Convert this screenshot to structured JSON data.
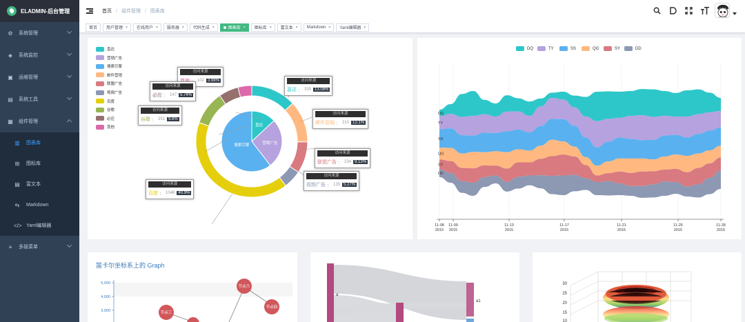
{
  "app": {
    "title": "ELADMIN-后台管理"
  },
  "sidebar": {
    "items": [
      {
        "label": "系统管理",
        "icon": "gear-icon",
        "glyph": "⚙"
      },
      {
        "label": "系统监控",
        "icon": "monitor-icon",
        "glyph": "◈"
      },
      {
        "label": "运维管理",
        "icon": "server-icon",
        "glyph": "▣"
      },
      {
        "label": "系统工具",
        "icon": "toolbox-icon",
        "glyph": "▤"
      },
      {
        "label": "组件管理",
        "icon": "grid-icon",
        "glyph": "▦"
      }
    ],
    "subitems": [
      {
        "label": "图表库",
        "icon": "chart-icon",
        "glyph": "▥",
        "active": true
      },
      {
        "label": "图标库",
        "icon": "icons-icon",
        "glyph": "⊞"
      },
      {
        "label": "富文本",
        "icon": "richtext-icon",
        "glyph": "▤"
      },
      {
        "label": "Markdown",
        "icon": "markdown-icon",
        "glyph": "⇆"
      },
      {
        "label": "Yaml编辑器",
        "icon": "code-icon",
        "glyph": "</>"
      }
    ],
    "after": [
      {
        "label": "多级菜单",
        "icon": "menu-icon",
        "glyph": "≡"
      }
    ]
  },
  "breadcrumb": [
    "首页",
    "组件管理",
    "图表库"
  ],
  "tags": [
    {
      "label": "首页",
      "closable": false
    },
    {
      "label": "用户管理",
      "closable": true
    },
    {
      "label": "在线用户",
      "closable": true
    },
    {
      "label": "服务器",
      "closable": true
    },
    {
      "label": "代码生成",
      "closable": true
    },
    {
      "label": "图表库",
      "closable": true,
      "active": true
    },
    {
      "label": "图标库",
      "closable": true
    },
    {
      "label": "富文本",
      "closable": true
    },
    {
      "label": "Markdown",
      "closable": true
    },
    {
      "label": "Yaml编辑器",
      "closable": true
    }
  ],
  "colors": {
    "accent": "#409eff",
    "tag_active": "#42b983",
    "sidebar_bg": "#304156"
  },
  "chart_data": [
    {
      "type": "pie",
      "legend": [
        "直达",
        "营销广告",
        "搜索引擎",
        "邮件营销",
        "联盟广告",
        "视频广告",
        "百度",
        "谷歌",
        "必应",
        "其他"
      ],
      "legend_colors": [
        "#2ec7c9",
        "#b6a2de",
        "#5ab1ef",
        "#ffb980",
        "#d87a80",
        "#8d98b3",
        "#e5cf0d",
        "#97b552",
        "#95706d",
        "#dc69aa"
      ],
      "inner": [
        {
          "name": "直达",
          "value": 335,
          "color": "#2ec7c9"
        },
        {
          "name": "营销广告",
          "value": 679,
          "color": "#b6a2de"
        },
        {
          "name": "搜索引擎",
          "value": 1548,
          "color": "#5ab1ef"
        }
      ],
      "outer": [
        {
          "name": "直达",
          "value": 335,
          "color": "#2ec7c9"
        },
        {
          "name": "邮件营销",
          "value": 310,
          "color": "#ffb980"
        },
        {
          "name": "联盟广告",
          "value": 234,
          "color": "#d87a80"
        },
        {
          "name": "视频广告",
          "value": 135,
          "color": "#8d98b3"
        },
        {
          "name": "百度",
          "value": 1048,
          "color": "#e5cf0d"
        },
        {
          "name": "谷歌",
          "value": 251,
          "color": "#97b552"
        },
        {
          "name": "必应",
          "value": 147,
          "color": "#95706d"
        },
        {
          "name": "其他",
          "value": 102,
          "color": "#dc69aa"
        }
      ],
      "tooltips": [
        {
          "title": "访问来源",
          "name": "其他",
          "value": "102",
          "pct": "3.98%",
          "color": "#dc69aa"
        },
        {
          "title": "访问来源",
          "name": "必应",
          "value": "147",
          "pct": "5.74%",
          "color": "#95706d"
        },
        {
          "title": "访问来源",
          "name": "谷歌",
          "value": "251",
          "pct": "9.8%",
          "color": "#97b552"
        },
        {
          "title": "访问来源",
          "name": "直达",
          "value": "335",
          "pct": "13.08%",
          "color": "#2ec7c9"
        },
        {
          "title": "访问来源",
          "name": "邮件营销",
          "value": "310",
          "pct": "12.1%",
          "color": "#ffb980"
        },
        {
          "title": "访问来源",
          "name": "联盟广告",
          "value": "234",
          "pct": "9.13%",
          "color": "#d87a80"
        },
        {
          "title": "访问来源",
          "name": "视频广告",
          "value": "135",
          "pct": "5.27%",
          "color": "#8d98b3"
        },
        {
          "title": "访问来源",
          "name": "百度",
          "value": "1048",
          "pct": "40.9%",
          "color": "#e5cf0d"
        }
      ]
    },
    {
      "type": "area",
      "subtype": "themeRiver",
      "legend": [
        "DQ",
        "TY",
        "SS",
        "QG",
        "SY",
        "DD"
      ],
      "colors": [
        "#2ec7c9",
        "#b6a2de",
        "#5ab1ef",
        "#ffb980",
        "#d87a80",
        "#8d98b3"
      ],
      "x_ticks": [
        {
          "label": "11-08",
          "year": "2015"
        },
        {
          "label": "11-09",
          "year": "2015"
        },
        {
          "label": "11-13",
          "year": "2015"
        },
        {
          "label": "11-17",
          "year": "2015"
        },
        {
          "label": "11-21",
          "year": "2015"
        },
        {
          "label": "11-25",
          "year": "2015"
        },
        {
          "label": "11-28",
          "year": "2015"
        }
      ],
      "series": [
        {
          "name": "DQ",
          "values": [
            10,
            15,
            35,
            38,
            22,
            20,
            25,
            20,
            22,
            12,
            8,
            12,
            18,
            30,
            45,
            42,
            40,
            38,
            40,
            42,
            38,
            36,
            40,
            38,
            30,
            20
          ]
        },
        {
          "name": "TY",
          "values": [
            20,
            22,
            28,
            30,
            28,
            25,
            30,
            28,
            25,
            30,
            32,
            30,
            28,
            32,
            40,
            35,
            30,
            35,
            38,
            35,
            30,
            28,
            32,
            30,
            28,
            25
          ]
        },
        {
          "name": "SS",
          "values": [
            28,
            30,
            28,
            25,
            30,
            28,
            32,
            30,
            28,
            30,
            32,
            34,
            32,
            30,
            28,
            30,
            32,
            30,
            28,
            30,
            32,
            30,
            28,
            30,
            30,
            28
          ]
        },
        {
          "name": "QG",
          "values": [
            18,
            20,
            22,
            25,
            20,
            22,
            25,
            20,
            18,
            20,
            25,
            20,
            15,
            12,
            15,
            18,
            20,
            22,
            20,
            18,
            20,
            22,
            25,
            22,
            20,
            18
          ]
        },
        {
          "name": "SY",
          "values": [
            15,
            18,
            20,
            22,
            18,
            15,
            20,
            22,
            20,
            25,
            30,
            32,
            28,
            20,
            10,
            12,
            18,
            20,
            22,
            20,
            18,
            20,
            22,
            25,
            22,
            20
          ]
        },
        {
          "name": "DD",
          "values": [
            12,
            15,
            18,
            20,
            15,
            12,
            15,
            18,
            15,
            20,
            28,
            30,
            25,
            18,
            20,
            22,
            18,
            15,
            18,
            20,
            22,
            18,
            15,
            20,
            25,
            28
          ]
        }
      ]
    },
    {
      "type": "scatter",
      "subtype": "graph",
      "title": "笛卡尔坐标系上的 Graph",
      "y_ticks": [
        "5,000",
        "4,000",
        "3,000"
      ],
      "nodes": [
        {
          "name": "节点三",
          "value": 2900
        },
        {
          "name": "节点六",
          "value": 4700
        },
        {
          "name": "节点四",
          "value": 3200
        }
      ]
    },
    {
      "type": "other",
      "subtype": "sankey",
      "labels": [
        "a",
        "a1"
      ]
    },
    {
      "type": "other",
      "subtype": "surface3d",
      "z_ticks": [
        "30",
        "25",
        "20",
        "15",
        "10"
      ]
    }
  ]
}
